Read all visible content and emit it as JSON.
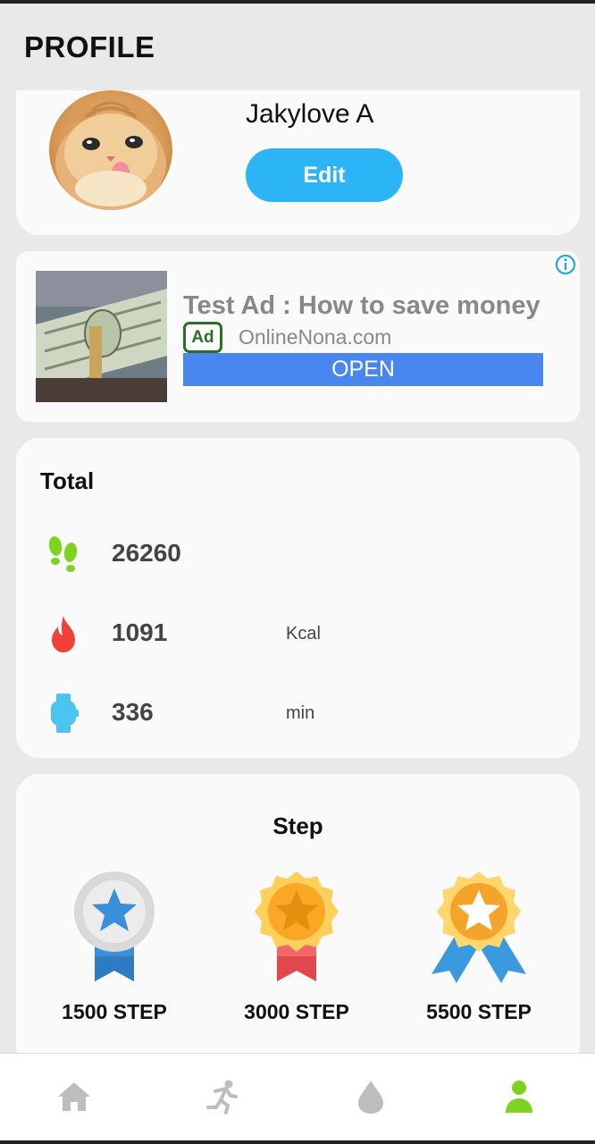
{
  "header": {
    "title": "PROFILE"
  },
  "profile": {
    "name": "Jakylove A",
    "edit_label": "Edit"
  },
  "ad": {
    "title": "Test Ad : How to save money",
    "badge": "Ad",
    "domain": "OnlineNona.com",
    "cta": "OPEN",
    "cta_color": "#4a86f0",
    "badge_color": "#2f6b2a"
  },
  "total": {
    "title": "Total",
    "stats": [
      {
        "icon": "footsteps-icon",
        "value": "26260",
        "unit": "",
        "color": "#7ed321"
      },
      {
        "icon": "flame-icon",
        "value": "1091",
        "unit": "Kcal",
        "color": "#f2403a"
      },
      {
        "icon": "watch-icon",
        "value": "336",
        "unit": "min",
        "color": "#4cc3f0"
      }
    ]
  },
  "steps": {
    "title": "Step",
    "medals": [
      {
        "icon": "silver-medal-icon",
        "label": "1500 STEP"
      },
      {
        "icon": "gold-medal-icon",
        "label": "3000 STEP"
      },
      {
        "icon": "gold-star-medal-icon",
        "label": "5500 STEP"
      }
    ]
  },
  "nav": {
    "items": [
      {
        "icon": "home-icon"
      },
      {
        "icon": "running-icon"
      },
      {
        "icon": "water-drop-icon"
      },
      {
        "icon": "profile-icon",
        "active": true
      }
    ],
    "active_color": "#7ed321",
    "inactive_color": "#bdbdbd"
  },
  "colors": {
    "accent": "#2bb4f6",
    "background": "#e9e9e9",
    "card": "#fafafa"
  }
}
